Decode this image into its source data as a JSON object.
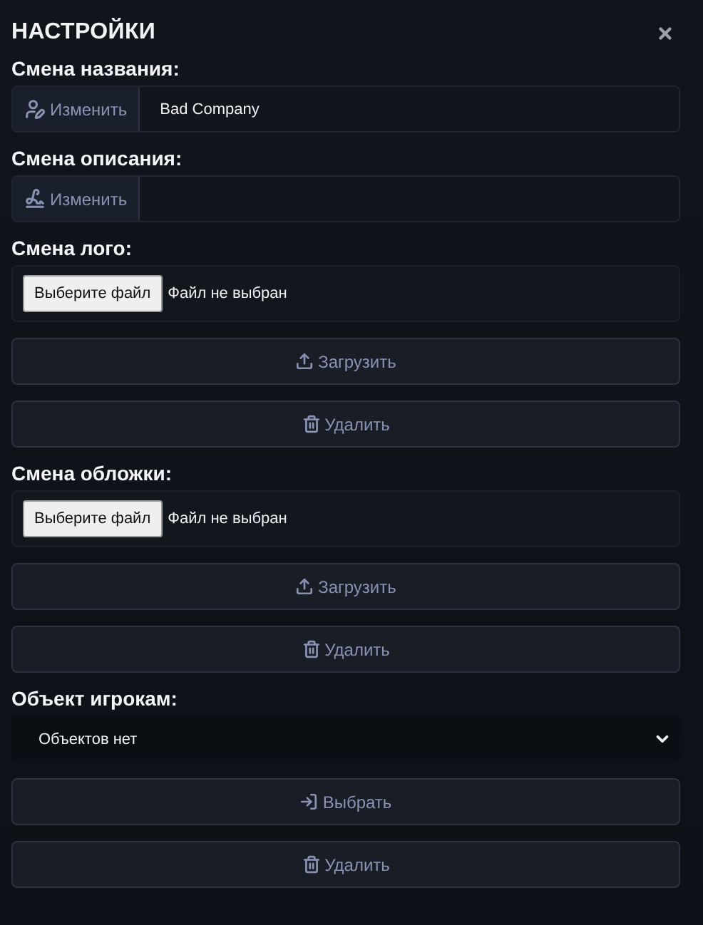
{
  "title": "НАСТРОЙКИ",
  "sections": [
    {
      "kind": "text",
      "label": "Смена названия:",
      "button": {
        "label": "Изменить",
        "kind": "name"
      },
      "value": "Bad Company"
    },
    {
      "kind": "text",
      "label": "Смена описания:",
      "button": {
        "label": "Изменить",
        "kind": "description"
      }
    },
    {
      "kind": "file",
      "label": "Смена лого:",
      "file_button": "Выберите файл",
      "file_status": "Файл не выбран",
      "actions": [
        {
          "label": "Загрузить",
          "kind": "upload"
        },
        {
          "label": "Удалить",
          "kind": "delete"
        }
      ]
    },
    {
      "kind": "file",
      "label": "Смена обложки:",
      "file_button": "Выберите файл",
      "file_status": "Файл не выбран",
      "actions": [
        {
          "label": "Загрузить",
          "kind": "upload"
        },
        {
          "label": "Удалить",
          "kind": "delete"
        }
      ]
    },
    {
      "kind": "select",
      "label": "Объект игрокам:",
      "value": "Объектов нет",
      "actions": [
        {
          "label": "Выбрать",
          "kind": "choose"
        },
        {
          "label": "Удалить",
          "kind": "delete"
        }
      ]
    }
  ]
}
